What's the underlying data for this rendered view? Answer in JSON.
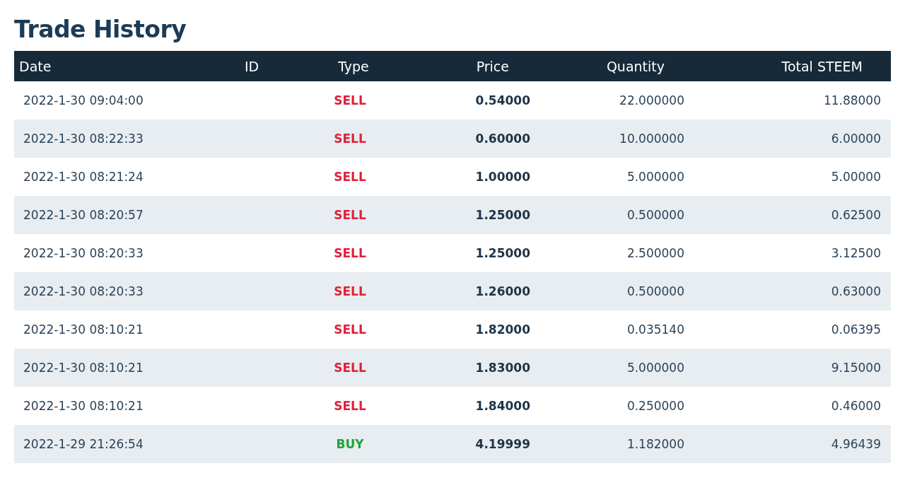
{
  "title": "Trade History",
  "table": {
    "columns": [
      "Date",
      "ID",
      "Type",
      "Price",
      "Quantity",
      "Total STEEM"
    ],
    "rows": [
      {
        "date": "2022-1-30 09:04:00",
        "type": {
          "label": "SELL",
          "kind": "sell"
        },
        "price": "0.54000",
        "quantity": "22.000000",
        "total": "11.88000"
      },
      {
        "date": "2022-1-30 08:22:33",
        "type": {
          "label": "SELL",
          "kind": "sell"
        },
        "price": "0.60000",
        "quantity": "10.000000",
        "total": "6.00000"
      },
      {
        "date": "2022-1-30 08:21:24",
        "type": {
          "label": "SELL",
          "kind": "sell"
        },
        "price": "1.00000",
        "quantity": "5.000000",
        "total": "5.00000"
      },
      {
        "date": "2022-1-30 08:20:57",
        "type": {
          "label": "SELL",
          "kind": "sell"
        },
        "price": "1.25000",
        "quantity": "0.500000",
        "total": "0.62500"
      },
      {
        "date": "2022-1-30 08:20:33",
        "type": {
          "label": "SELL",
          "kind": "sell"
        },
        "price": "1.25000",
        "quantity": "2.500000",
        "total": "3.12500"
      },
      {
        "date": "2022-1-30 08:20:33",
        "type": {
          "label": "SELL",
          "kind": "sell"
        },
        "price": "1.26000",
        "quantity": "0.500000",
        "total": "0.63000"
      },
      {
        "date": "2022-1-30 08:10:21",
        "type": {
          "label": "SELL",
          "kind": "sell"
        },
        "price": "1.82000",
        "quantity": "0.035140",
        "total": "0.06395"
      },
      {
        "date": "2022-1-30 08:10:21",
        "type": {
          "label": "SELL",
          "kind": "sell"
        },
        "price": "1.83000",
        "quantity": "5.000000",
        "total": "9.15000"
      },
      {
        "date": "2022-1-30 08:10:21",
        "type": {
          "label": "SELL",
          "kind": "sell"
        },
        "price": "1.84000",
        "quantity": "0.250000",
        "total": "0.46000"
      },
      {
        "date": "2022-1-29 21:26:54",
        "type": {
          "label": "BUY",
          "kind": "buy"
        },
        "price": "4.19999",
        "quantity": "1.182000",
        "total": "4.96439"
      }
    ]
  }
}
